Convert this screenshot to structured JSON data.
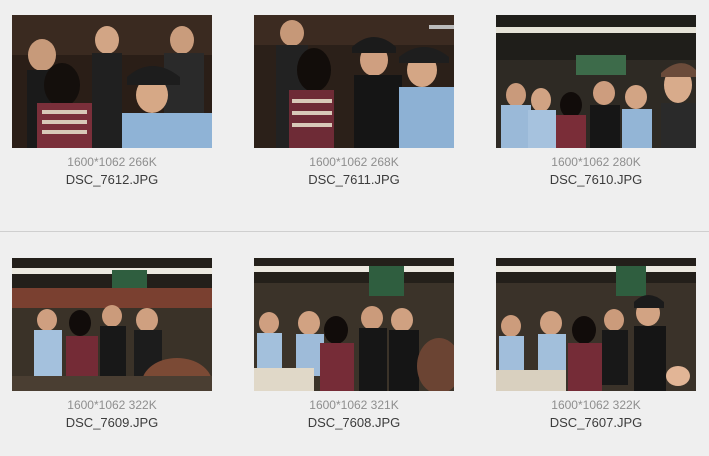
{
  "photos": [
    {
      "meta": "1600*1062 266K",
      "filename": "DSC_7612.JPG"
    },
    {
      "meta": "1600*1062 268K",
      "filename": "DSC_7611.JPG"
    },
    {
      "meta": "1600*1062 280K",
      "filename": "DSC_7610.JPG"
    },
    {
      "meta": "1600*1062 322K",
      "filename": "DSC_7609.JPG"
    },
    {
      "meta": "1600*1062 321K",
      "filename": "DSC_7608.JPG"
    },
    {
      "meta": "1600*1062 322K",
      "filename": "DSC_7607.JPG"
    }
  ]
}
